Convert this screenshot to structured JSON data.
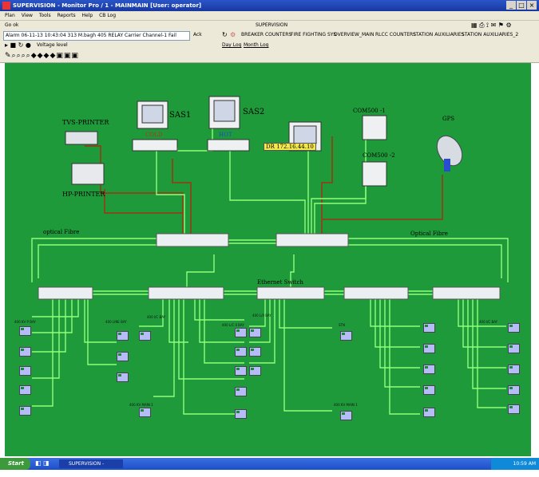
{
  "window": {
    "title": "SUPERVISION - Monitor Pro / 1 - MAINMAIN [User: operator]",
    "buttons": [
      "_",
      "□",
      "×"
    ]
  },
  "menu": [
    "Plan",
    "View",
    "Tools",
    "Reports",
    "Help",
    "CB Log"
  ],
  "toolbar1": {
    "go_label": "Go  ok",
    "center_title": "SUPERVISION"
  },
  "toolbar2": {
    "alarm_text": "Alarm 06-11-13 10:43:04 313 M.bagh  405  RELAY Carrier Channel-1 Fail",
    "alarm_ack": "Ack",
    "nav_links": [
      "BREAKER COUNTERS",
      "FIRE FIGHTING SYS",
      "OVERVIEW_MAIN",
      "RLCC COUNTERS",
      "STATION AUXILIARIES",
      "STATION AUXILIARIES_2"
    ]
  },
  "toolbar3": {
    "voltage_level": "Voltage level",
    "log1": "Day Log",
    "log2": "Month Log"
  },
  "colors": {
    "canvas": "#1f9a3b",
    "link": "#8fff7a",
    "red_link": "#9a3412",
    "ied_fill": "#b5bcf6"
  },
  "diagram": {
    "devices": {
      "tvs_printer": "TVS-PRINTER",
      "hp_printer": "HP-PRINTER",
      "sas1": "SAS1",
      "sas1_state": "COLD",
      "sas2": "SAS2",
      "sas2_state": "HOT",
      "dr_ip": "DR 172.16.44.10",
      "com500_1": "COM500 -1",
      "com500_2": "COM500 -2",
      "gps": "GPS"
    },
    "network": {
      "optical_left": "optical Fibre",
      "optical_right": "Optical Fibre",
      "ethernet_switch": "Ethernet Switch"
    },
    "bays": [
      "400 KV P BAY",
      "400 LINE BAY",
      "400 I/C BAY",
      "400 L/C II BAY",
      "400 L/II BAY",
      "STN",
      "400 I/C BAY"
    ],
    "mains": [
      "400 KV MAIN 1",
      "400 KV MAIN 1"
    ]
  },
  "taskbar": {
    "start": "Start",
    "app": "SUPERVISION - Monit...",
    "clock": "10:59 AM"
  }
}
